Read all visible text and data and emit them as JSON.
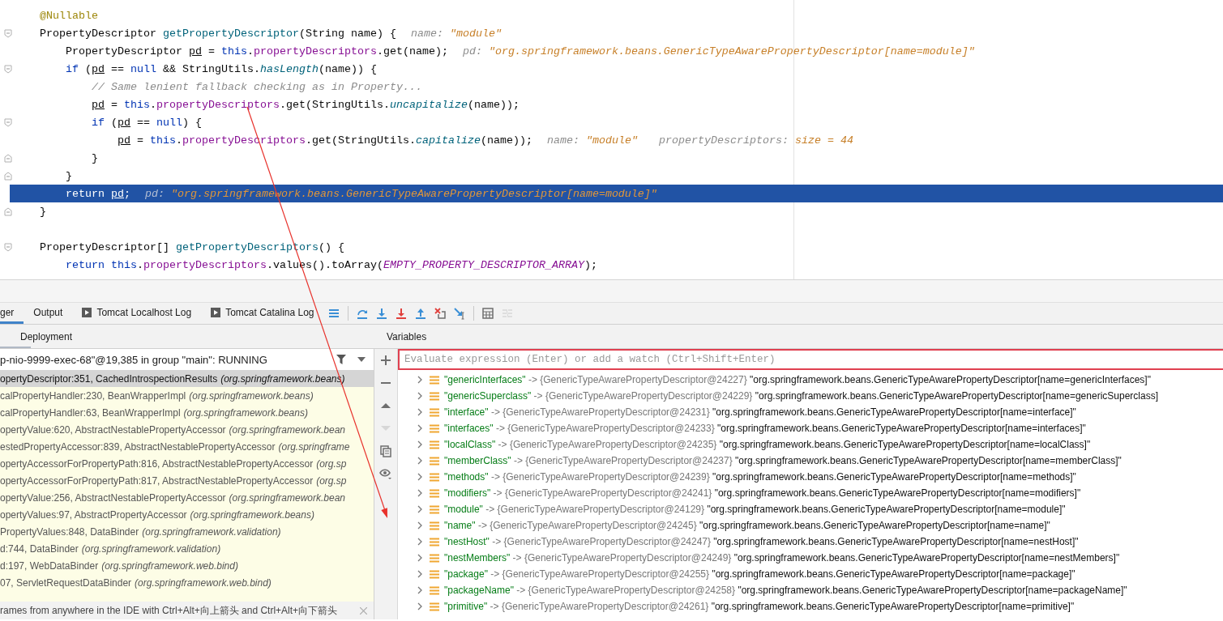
{
  "editor": {
    "lines": [
      {
        "selected": false,
        "fold_start": false,
        "fold_end": false,
        "tokens": [
          {
            "text": "@Nullable",
            "kind": "annotation"
          }
        ]
      },
      {
        "selected": false,
        "fold_start": true,
        "fold_end": false,
        "tokens": [
          {
            "text": "PropertyDescriptor ",
            "kind": "plain"
          },
          {
            "text": "getPropertyDescriptor",
            "kind": "decl"
          },
          {
            "text": "(String name) {",
            "kind": "plain"
          }
        ],
        "hints": [
          {
            "name": "name:",
            "value": "\"module\""
          }
        ]
      },
      {
        "selected": false,
        "fold_start": false,
        "fold_end": false,
        "tokens": [
          {
            "text": "    PropertyDescriptor ",
            "kind": "plain"
          },
          {
            "text": "pd",
            "kind": "var"
          },
          {
            "text": " = ",
            "kind": "plain"
          },
          {
            "text": "this",
            "kind": "keyword"
          },
          {
            "text": ".",
            "kind": "plain"
          },
          {
            "text": "propertyDescriptors",
            "kind": "field"
          },
          {
            "text": ".get(name);",
            "kind": "plain"
          }
        ],
        "hints": [
          {
            "name": "pd:",
            "value": "\"org.springframework.beans.GenericTypeAwarePropertyDescriptor[name=module]\""
          }
        ]
      },
      {
        "selected": false,
        "fold_start": true,
        "fold_end": false,
        "tokens": [
          {
            "text": "    if",
            "kind": "keyword"
          },
          {
            "text": " (",
            "kind": "plain"
          },
          {
            "text": "pd",
            "kind": "var"
          },
          {
            "text": " == ",
            "kind": "plain"
          },
          {
            "text": "null",
            "kind": "keyword"
          },
          {
            "text": " && StringUtils.",
            "kind": "plain"
          },
          {
            "text": "hasLength",
            "kind": "static"
          },
          {
            "text": "(name)) {",
            "kind": "plain"
          }
        ]
      },
      {
        "selected": false,
        "fold_start": false,
        "fold_end": false,
        "tokens": [
          {
            "text": "        // Same lenient fallback checking as in Property...",
            "kind": "comment"
          }
        ]
      },
      {
        "selected": false,
        "fold_start": false,
        "fold_end": false,
        "tokens": [
          {
            "text": "        pd",
            "kind": "var"
          },
          {
            "text": " = ",
            "kind": "plain"
          },
          {
            "text": "this",
            "kind": "keyword"
          },
          {
            "text": ".",
            "kind": "plain"
          },
          {
            "text": "propertyDescriptors",
            "kind": "field"
          },
          {
            "text": ".get(StringUtils.",
            "kind": "plain"
          },
          {
            "text": "uncapitalize",
            "kind": "static"
          },
          {
            "text": "(name));",
            "kind": "plain"
          }
        ]
      },
      {
        "selected": false,
        "fold_start": true,
        "fold_end": false,
        "tokens": [
          {
            "text": "        if",
            "kind": "keyword"
          },
          {
            "text": " (",
            "kind": "plain"
          },
          {
            "text": "pd",
            "kind": "var"
          },
          {
            "text": " == ",
            "kind": "plain"
          },
          {
            "text": "null",
            "kind": "keyword"
          },
          {
            "text": ") {",
            "kind": "plain"
          }
        ]
      },
      {
        "selected": false,
        "fold_start": false,
        "fold_end": false,
        "tokens": [
          {
            "text": "            pd",
            "kind": "var"
          },
          {
            "text": " = ",
            "kind": "plain"
          },
          {
            "text": "this",
            "kind": "keyword"
          },
          {
            "text": ".",
            "kind": "plain"
          },
          {
            "text": "propertyDescriptors",
            "kind": "field"
          },
          {
            "text": ".get(StringUtils.",
            "kind": "plain"
          },
          {
            "text": "capitalize",
            "kind": "static"
          },
          {
            "text": "(name));",
            "kind": "plain"
          }
        ],
        "hints": [
          {
            "name": "name:",
            "value": "\"module\""
          },
          {
            "name": "propertyDescriptors:",
            "value": "size = 44"
          }
        ]
      },
      {
        "selected": false,
        "fold_start": false,
        "fold_end": true,
        "tokens": [
          {
            "text": "        }",
            "kind": "plain"
          }
        ]
      },
      {
        "selected": false,
        "fold_start": false,
        "fold_end": true,
        "tokens": [
          {
            "text": "    }",
            "kind": "plain"
          }
        ]
      },
      {
        "selected": true,
        "fold_start": false,
        "fold_end": false,
        "tokens": [
          {
            "text": "    return ",
            "kind": "keyword"
          },
          {
            "text": "pd",
            "kind": "var"
          },
          {
            "text": ";",
            "kind": "plain"
          }
        ],
        "hints": [
          {
            "name": "pd:",
            "value": "\"org.springframework.beans.GenericTypeAwarePropertyDescriptor[name=module]\""
          }
        ]
      },
      {
        "selected": false,
        "fold_start": false,
        "fold_end": true,
        "tokens": [
          {
            "text": "}",
            "kind": "plain"
          }
        ]
      },
      {
        "selected": false,
        "fold_start": false,
        "fold_end": false
      },
      {
        "selected": false,
        "fold_start": true,
        "fold_end": false,
        "tokens": [
          {
            "text": "PropertyDescriptor[] ",
            "kind": "plain"
          },
          {
            "text": "getPropertyDescriptors",
            "kind": "decl"
          },
          {
            "text": "() {",
            "kind": "plain"
          }
        ]
      },
      {
        "selected": false,
        "fold_start": false,
        "fold_end": false,
        "tokens": [
          {
            "text": "    return ",
            "kind": "keyword"
          },
          {
            "text": "this",
            "kind": "keyword"
          },
          {
            "text": ".",
            "kind": "plain"
          },
          {
            "text": "propertyDescriptors",
            "kind": "field"
          },
          {
            "text": ".values().toArray(",
            "kind": "plain"
          },
          {
            "text": "EMPTY_PROPERTY_DESCRIPTOR_ARRAY",
            "kind": "constant"
          },
          {
            "text": ");",
            "kind": "plain"
          }
        ]
      }
    ]
  },
  "tabs": [
    {
      "label": "ger",
      "kind": "plain",
      "selected": true
    },
    {
      "label": "Output",
      "kind": "plain",
      "selected": false
    },
    {
      "label": "Tomcat Localhost Log",
      "kind": "log",
      "selected": false
    },
    {
      "label": "Tomcat Catalina Log",
      "kind": "log",
      "selected": false
    }
  ],
  "toolbar": [
    {
      "kind": "menu",
      "disabled": false
    },
    {
      "kind": "separator"
    },
    {
      "kind": "step-over",
      "disabled": false
    },
    {
      "kind": "step-into",
      "disabled": false
    },
    {
      "kind": "force-step-into",
      "disabled": false
    },
    {
      "kind": "step-out",
      "disabled": false
    },
    {
      "kind": "drop-frame",
      "disabled": false
    },
    {
      "kind": "run-to-cursor",
      "disabled": false
    },
    {
      "kind": "separator"
    },
    {
      "kind": "evaluate",
      "disabled": false
    },
    {
      "kind": "trace",
      "disabled": true
    }
  ],
  "frames_panel": {
    "title": "Deployment",
    "thread": "p-nio-9999-exec-68\"@19,385 in group \"main\": RUNNING",
    "frames": [
      {
        "location": "opertyDescriptor:351, CachedIntrospectionResults",
        "package": "(org.springframework.beans)",
        "selected": true
      },
      {
        "location": "calPropertyHandler:230, BeanWrapperImpl",
        "package": "(org.springframework.beans)",
        "selected": false
      },
      {
        "location": "calPropertyHandler:63, BeanWrapperImpl",
        "package": "(org.springframework.beans)",
        "selected": false
      },
      {
        "location": "opertyValue:620, AbstractNestablePropertyAccessor",
        "package": "(org.springframework.bean",
        "selected": false
      },
      {
        "location": "estedPropertyAccessor:839, AbstractNestablePropertyAccessor",
        "package": "(org.springframe",
        "selected": false
      },
      {
        "location": "opertyAccessorForPropertyPath:816, AbstractNestablePropertyAccessor",
        "package": "(org.sp",
        "selected": false
      },
      {
        "location": "opertyAccessorForPropertyPath:817, AbstractNestablePropertyAccessor",
        "package": "(org.sp",
        "selected": false
      },
      {
        "location": "opertyValue:256, AbstractNestablePropertyAccessor",
        "package": "(org.springframework.bean",
        "selected": false
      },
      {
        "location": "opertyValues:97, AbstractPropertyAccessor",
        "package": "(org.springframework.beans)",
        "selected": false
      },
      {
        "location": "PropertyValues:848, DataBinder",
        "package": "(org.springframework.validation)",
        "selected": false
      },
      {
        "location": "d:744, DataBinder",
        "package": "(org.springframework.validation)",
        "selected": false
      },
      {
        "location": "d:197, WebDataBinder",
        "package": "(org.springframework.web.bind)",
        "selected": false
      },
      {
        "location": "07, ServletRequestDataBinder",
        "package": "(org.springframework.web.bind)",
        "selected": false
      }
    ],
    "tip": "rames from anywhere in the IDE with Ctrl+Alt+向上箭头 and Ctrl+Alt+向下箭头"
  },
  "side_toolbar": [
    {
      "kind": "add",
      "disabled": false
    },
    {
      "kind": "remove",
      "disabled": false
    },
    {
      "kind": "up",
      "disabled": false
    },
    {
      "kind": "down",
      "disabled": true
    },
    {
      "kind": "copy",
      "disabled": false
    },
    {
      "kind": "watch",
      "disabled": false
    }
  ],
  "variables": {
    "title": "Variables",
    "placeholder": "Evaluate expression (Enter) or add a watch (Ctrl+Shift+Enter)",
    "rows": [
      {
        "key": "\"genericInterfaces\"",
        "arrow": "->",
        "ref": "{GenericTypeAwarePropertyDescriptor@24227}",
        "value": "\"org.springframework.beans.GenericTypeAwarePropertyDescriptor[name=genericInterfaces]\""
      },
      {
        "key": "\"genericSuperclass\"",
        "arrow": "->",
        "ref": "{GenericTypeAwarePropertyDescriptor@24229}",
        "value": "\"org.springframework.beans.GenericTypeAwarePropertyDescriptor[name=genericSuperclass]"
      },
      {
        "key": "\"interface\"",
        "arrow": "->",
        "ref": "{GenericTypeAwarePropertyDescriptor@24231}",
        "value": "\"org.springframework.beans.GenericTypeAwarePropertyDescriptor[name=interface]\""
      },
      {
        "key": "\"interfaces\"",
        "arrow": "->",
        "ref": "{GenericTypeAwarePropertyDescriptor@24233}",
        "value": "\"org.springframework.beans.GenericTypeAwarePropertyDescriptor[name=interfaces]\""
      },
      {
        "key": "\"localClass\"",
        "arrow": "->",
        "ref": "{GenericTypeAwarePropertyDescriptor@24235}",
        "value": "\"org.springframework.beans.GenericTypeAwarePropertyDescriptor[name=localClass]\""
      },
      {
        "key": "\"memberClass\"",
        "arrow": "->",
        "ref": "{GenericTypeAwarePropertyDescriptor@24237}",
        "value": "\"org.springframework.beans.GenericTypeAwarePropertyDescriptor[name=memberClass]\""
      },
      {
        "key": "\"methods\"",
        "arrow": "->",
        "ref": "{GenericTypeAwarePropertyDescriptor@24239}",
        "value": "\"org.springframework.beans.GenericTypeAwarePropertyDescriptor[name=methods]\""
      },
      {
        "key": "\"modifiers\"",
        "arrow": "->",
        "ref": "{GenericTypeAwarePropertyDescriptor@24241}",
        "value": "\"org.springframework.beans.GenericTypeAwarePropertyDescriptor[name=modifiers]\""
      },
      {
        "key": "\"module\"",
        "arrow": "->",
        "ref": "{GenericTypeAwarePropertyDescriptor@24129}",
        "value": "\"org.springframework.beans.GenericTypeAwarePropertyDescriptor[name=module]\""
      },
      {
        "key": "\"name\"",
        "arrow": "->",
        "ref": "{GenericTypeAwarePropertyDescriptor@24245}",
        "value": "\"org.springframework.beans.GenericTypeAwarePropertyDescriptor[name=name]\""
      },
      {
        "key": "\"nestHost\"",
        "arrow": "->",
        "ref": "{GenericTypeAwarePropertyDescriptor@24247}",
        "value": "\"org.springframework.beans.GenericTypeAwarePropertyDescriptor[name=nestHost]\""
      },
      {
        "key": "\"nestMembers\"",
        "arrow": "->",
        "ref": "{GenericTypeAwarePropertyDescriptor@24249}",
        "value": "\"org.springframework.beans.GenericTypeAwarePropertyDescriptor[name=nestMembers]\""
      },
      {
        "key": "\"package\"",
        "arrow": "->",
        "ref": "{GenericTypeAwarePropertyDescriptor@24255}",
        "value": "\"org.springframework.beans.GenericTypeAwarePropertyDescriptor[name=package]\""
      },
      {
        "key": "\"packageName\"",
        "arrow": "->",
        "ref": "{GenericTypeAwarePropertyDescriptor@24258}",
        "value": "\"org.springframework.beans.GenericTypeAwarePropertyDescriptor[name=packageName]\""
      },
      {
        "key": "\"primitive\"",
        "arrow": "->",
        "ref": "{GenericTypeAwarePropertyDescriptor@24261}",
        "value": "\"org.springframework.beans.GenericTypeAwarePropertyDescriptor[name=primitive]\""
      }
    ]
  }
}
